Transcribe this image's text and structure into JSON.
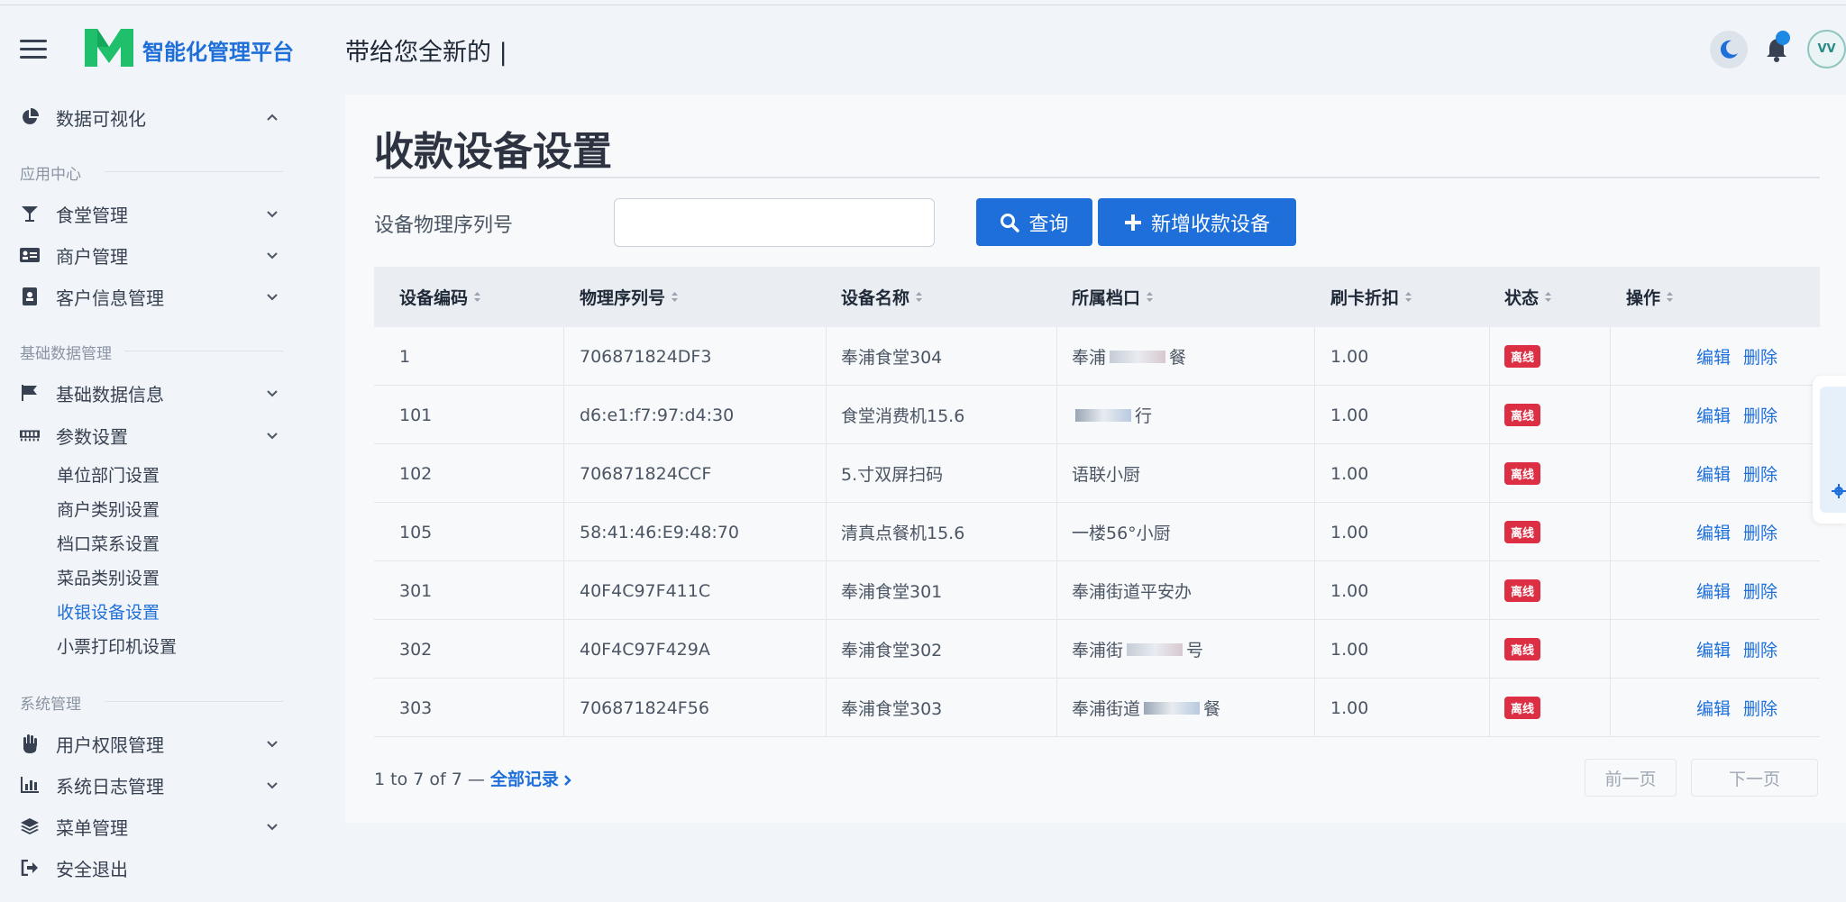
{
  "brand": {
    "name": "智能化管理平台"
  },
  "header": {
    "typing_text": "带给您全新的 |",
    "avatar_text": "VV"
  },
  "sidebar": {
    "dashboard": {
      "label": "数据可视化"
    },
    "section_app": "应用中心",
    "canteen": {
      "label": "食堂管理"
    },
    "merchant": {
      "label": "商户管理"
    },
    "customer": {
      "label": "客户信息管理"
    },
    "section_basic": "基础数据管理",
    "basic_info": {
      "label": "基础数据信息"
    },
    "params": {
      "label": "参数设置"
    },
    "sub_items": [
      "单位部门设置",
      "商户类别设置",
      "档口菜系设置",
      "菜品类别设置",
      "收银设备设置",
      "小票打印机设置"
    ],
    "section_system": "系统管理",
    "user_perm": {
      "label": "用户权限管理"
    },
    "sys_log": {
      "label": "系统日志管理"
    },
    "menu_mgmt": {
      "label": "菜单管理"
    },
    "logout": {
      "label": "安全退出"
    }
  },
  "main": {
    "title": "收款设备设置",
    "search_label": "设备物理序列号",
    "search_value": "",
    "query_button": "查询",
    "add_button": "新增收款设备"
  },
  "table": {
    "headers": [
      "设备编码",
      "物理序列号",
      "设备名称",
      "所属档口",
      "刷卡折扣",
      "状态",
      "操作"
    ],
    "rows": [
      {
        "code": "1",
        "serial": "706871824DF3",
        "name": "奉浦食堂304",
        "stall_pre": "奉浦",
        "stall_post": "餐",
        "discount": "1.00",
        "status": "离线"
      },
      {
        "code": "101",
        "serial": "d6:e1:f7:97:d4:30",
        "name": "食堂消费机15.6",
        "stall_pre": "",
        "stall_post": "行",
        "discount": "1.00",
        "status": "离线"
      },
      {
        "code": "102",
        "serial": "706871824CCF",
        "name": "5.寸双屏扫码",
        "stall_pre": "语联小厨",
        "stall_post": "",
        "discount": "1.00",
        "status": "离线"
      },
      {
        "code": "105",
        "serial": "58:41:46:E9:48:70",
        "name": "清真点餐机15.6",
        "stall_pre": "一楼56°小厨",
        "stall_post": "",
        "discount": "1.00",
        "status": "离线"
      },
      {
        "code": "301",
        "serial": "40F4C97F411C",
        "name": "奉浦食堂301",
        "stall_pre": "奉浦街道平安办",
        "stall_post": "",
        "discount": "1.00",
        "status": "离线"
      },
      {
        "code": "302",
        "serial": "40F4C97F429A",
        "name": "奉浦食堂302",
        "stall_pre": "奉浦街",
        "stall_post": "号",
        "discount": "1.00",
        "status": "离线"
      },
      {
        "code": "303",
        "serial": "706871824F56",
        "name": "奉浦食堂303",
        "stall_pre": "奉浦街道",
        "stall_post": "餐",
        "discount": "1.00",
        "status": "离线"
      }
    ],
    "edit_label": "编辑",
    "delete_label": "删除"
  },
  "pager": {
    "info": "1 to 7 of 7 — ",
    "all_records": "全部记录",
    "prev": "前一页",
    "next": "下一页"
  },
  "colors": {
    "accent": "#1e6fd9",
    "status_offline": "#dc2f44",
    "logo_green": "#1fbf6b"
  },
  "icons": [
    "menu-icon",
    "pie-chart-icon",
    "cocktail-icon",
    "id-card-icon",
    "address-book-icon",
    "flag-icon",
    "memory-icon",
    "hand-icon",
    "bar-chart-icon",
    "layers-icon",
    "sign-out-icon",
    "moon-icon",
    "bell-icon",
    "search-icon",
    "plus-icon"
  ]
}
